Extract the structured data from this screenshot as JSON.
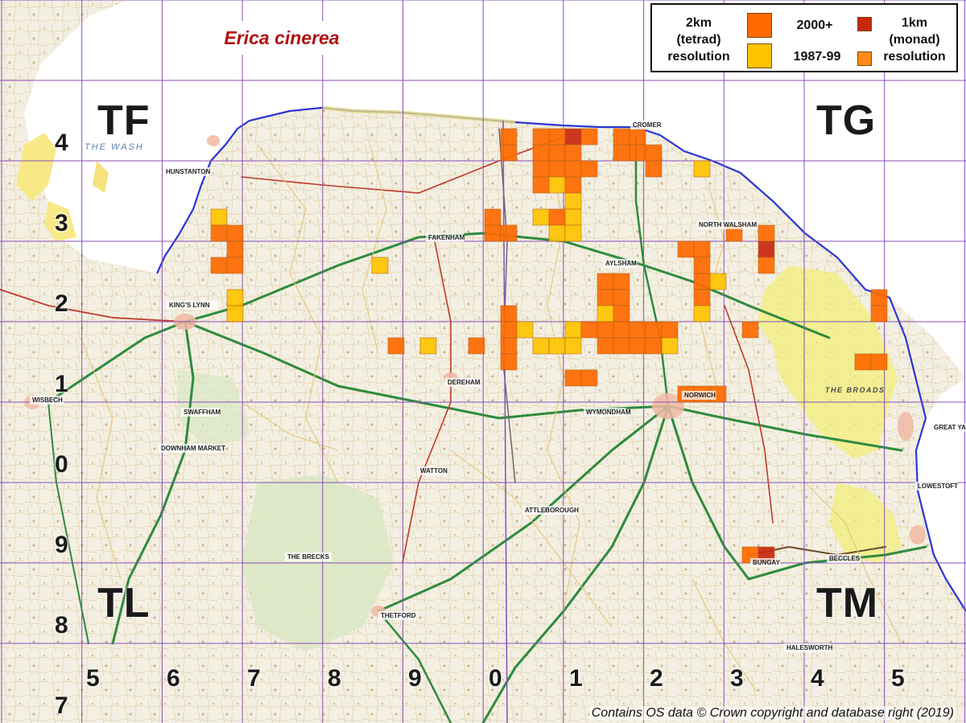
{
  "title": "Erica cinerea",
  "legend": {
    "tetrad_label_lines": [
      "2km",
      "(tetrad)",
      "resolution"
    ],
    "monad_label_lines": [
      "1km",
      "(monad)",
      "resolution"
    ],
    "period_recent": "2000+",
    "period_old": "1987-99"
  },
  "colors": {
    "recent": "#ff6a00",
    "old": "#ffc400",
    "monad": "#c8280f",
    "grid": "#8a4fb8",
    "sea": "#ffffff",
    "coast": "#2a36d6"
  },
  "square_labels": [
    "TF",
    "TG",
    "TL",
    "TM"
  ],
  "northing_labels": [
    "4",
    "3",
    "2",
    "1",
    "0",
    "9",
    "8",
    "7"
  ],
  "easting_labels": [
    "5",
    "6",
    "7",
    "8",
    "9",
    "0",
    "1",
    "2",
    "3",
    "4",
    "5"
  ],
  "attribution": "Contains OS data © Crown copyright and database right (2019)",
  "map_label_the_wash": "THE WASH",
  "map_label_the_broads": "THE BROADS",
  "map_place_labels": [
    "HUNSTANTON",
    "KING'S LYNN",
    "FAKENHAM",
    "DEREHAM",
    "CROMER",
    "NORWICH",
    "GREAT YARMOUTH",
    "LOWESTOFT",
    "THETFORD",
    "DOWNHAM MARKET",
    "SWAFFHAM",
    "WYMONDHAM",
    "ATTLEBOROUGH",
    "BECCLES",
    "BUNGAY",
    "WATTON",
    "HALESWORTH",
    "WISBECH",
    "AYLSHAM",
    "NORTH WALSHAM",
    "THE BRECKS"
  ]
}
